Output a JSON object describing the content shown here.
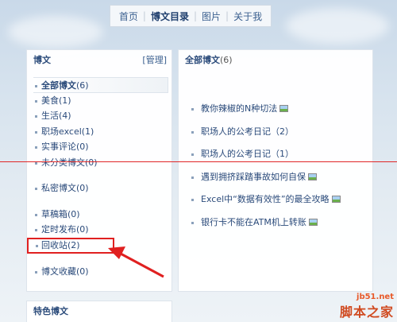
{
  "nav": {
    "items": [
      {
        "label": "首页",
        "active": false
      },
      {
        "label": "博文目录",
        "active": true
      },
      {
        "label": "图片",
        "active": false
      },
      {
        "label": "关于我",
        "active": false
      }
    ]
  },
  "left_panel": {
    "title": "博文",
    "manage_label": "[管理]",
    "categories": [
      {
        "label": "全部博文",
        "count": "(6)"
      },
      {
        "label": "美食",
        "count": "(1)"
      },
      {
        "label": "生活",
        "count": "(4)"
      },
      {
        "label": "职场excel",
        "count": "(1)"
      },
      {
        "label": "实事评论",
        "count": "(0)"
      },
      {
        "label": "未分类博文",
        "count": "(0)"
      },
      {
        "label": "私密博文",
        "count": "(0)"
      },
      {
        "label": "草稿箱",
        "count": "(0)"
      },
      {
        "label": "定时发布",
        "count": "(0)"
      },
      {
        "label": "回收站",
        "count": "(2)"
      },
      {
        "label": "博文收藏",
        "count": "(0)"
      }
    ]
  },
  "right_panel": {
    "title": "全部博文",
    "count": "(6)",
    "articles": [
      {
        "title": "教你辣椒的N种切法",
        "has_image": true
      },
      {
        "title": "职场人的公考日记（2）",
        "has_image": false
      },
      {
        "title": "职场人的公考日记（1）",
        "has_image": false
      },
      {
        "title": "遇到拥挤踩踏事故如何自保",
        "has_image": true
      },
      {
        "title": "Excel中“数据有效性”的最全攻略",
        "has_image": true
      },
      {
        "title": "银行卡不能在ATM机上转账",
        "has_image": true
      }
    ]
  },
  "feature_panel": {
    "title": "特色博文"
  },
  "watermark": {
    "url": "jb51.net",
    "text": "脚本之家"
  },
  "colors": {
    "annotation_red": "#e02020",
    "link_blue": "#2a4a7a"
  }
}
